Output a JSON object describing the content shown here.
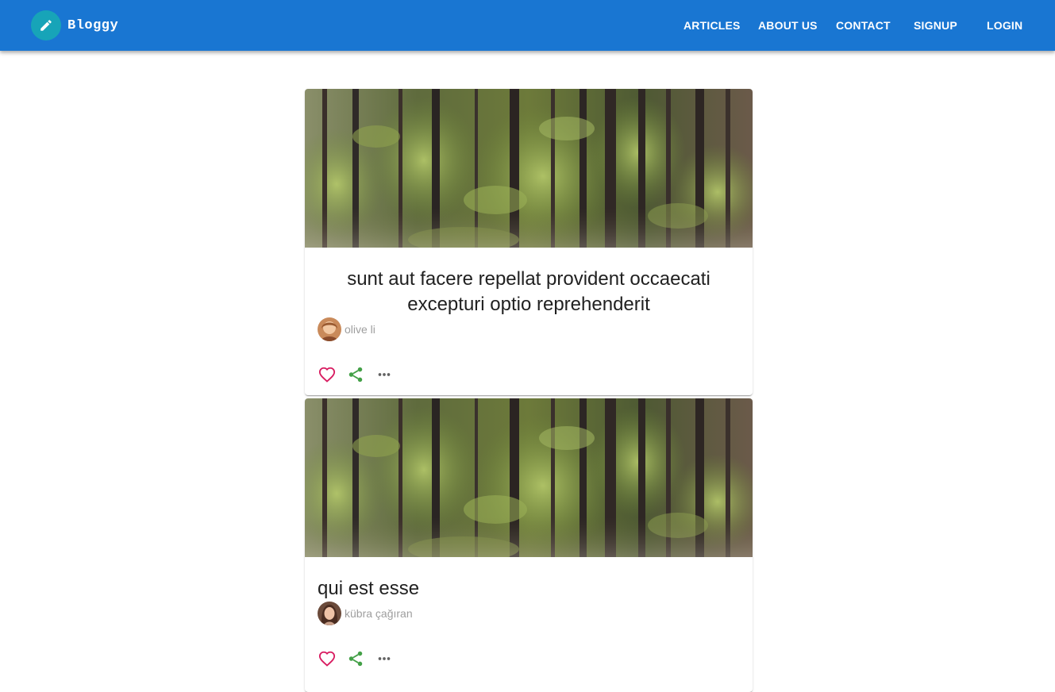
{
  "app": {
    "name": "Bloggy",
    "logo_icon": "pencil-icon",
    "colors": {
      "appbar": "#1976d2",
      "logo_badge": "#17a4b8",
      "like": "#d81b60",
      "share": "#43a047",
      "more": "#616161"
    }
  },
  "nav": {
    "items": [
      {
        "label": "ARTICLES"
      },
      {
        "label": "ABOUT US"
      },
      {
        "label": "CONTACT"
      },
      {
        "label": "SIGNUP"
      },
      {
        "label": "LOGIN"
      }
    ]
  },
  "posts": [
    {
      "title": "sunt aut facere repellat provident occaecati excepturi optio reprehenderit",
      "author": "olive li",
      "image": "forest-photo",
      "actions": [
        "heart-icon",
        "share-icon",
        "more-horiz-icon"
      ]
    },
    {
      "title": "qui est esse",
      "author": "kübra çağıran",
      "image": "forest-photo",
      "actions": [
        "heart-icon",
        "share-icon",
        "more-horiz-icon"
      ]
    }
  ]
}
